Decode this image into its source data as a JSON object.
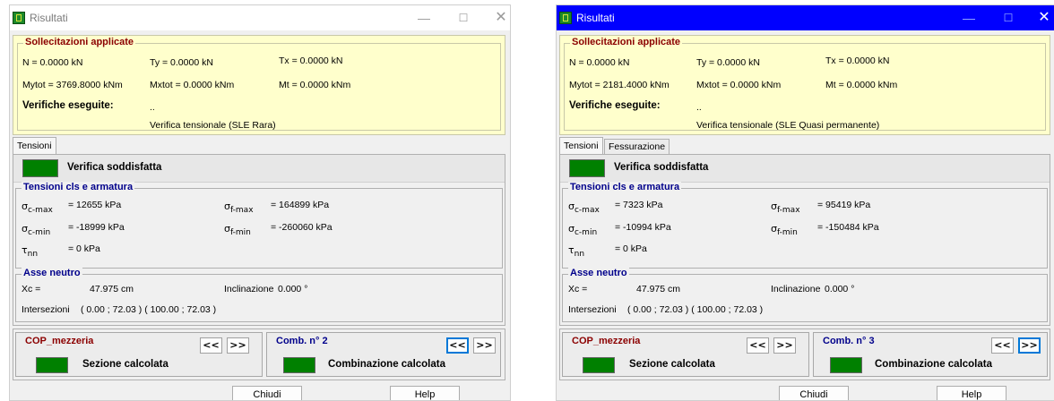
{
  "windows": [
    {
      "title": "Risultati",
      "sollecitazioni": {
        "legend": "Sollecitazioni applicate",
        "N": "N = 0.0000 kN",
        "Ty": "Ty = 0.0000 kN",
        "Tx": "Tx = 0.0000 kN",
        "Mytot": "Mytot = 3769.8000 kNm",
        "Mxtot": "Mxtot = 0.0000 kNm",
        "Mt": "Mt = 0.0000 kNm",
        "verifiche_label": "Verifiche eseguite:",
        "verifiche_value": "..",
        "verifica_tipo": "Verifica tensionale (SLE Rara)"
      },
      "tabs": [
        "Tensioni"
      ],
      "verifica": "Verifica soddisfatta",
      "tensioni": {
        "legend": "Tensioni cls e armatura",
        "sigma": "σ",
        "tau": "τ",
        "sub_cmax": "c-max",
        "sub_cmin": "c-min",
        "sub_fmax": "f-max",
        "sub_fmin": "f-min",
        "sub_nn": "nn",
        "c_max": "= 12655 kPa",
        "c_min": "= -18999 kPa",
        "f_max": "= 164899 kPa",
        "f_min": "= -260060 kPa",
        "nn": "= 0 kPa"
      },
      "asse": {
        "legend": "Asse neutro",
        "xc_label": "Xc =",
        "xc_value": "47.975 cm",
        "incl_label": "Inclinazione",
        "incl_value": "0.000 °",
        "inters_label": "Intersezioni",
        "inters_value": "( 0.00 ; 72.03 ) ( 100.00 ; 72.03 )"
      },
      "sezione": {
        "name": "COP_mezzeria",
        "status": "Sezione calcolata"
      },
      "combinazione": {
        "name": "Comb. n° 2",
        "status": "Combinazione calcolata"
      },
      "nav": {
        "prev": "<<",
        "next": ">>"
      },
      "buttons": {
        "close": "Chiudi",
        "help": "Help"
      }
    },
    {
      "title": "Risultati",
      "sollecitazioni": {
        "legend": "Sollecitazioni applicate",
        "N": "N = 0.0000 kN",
        "Ty": "Ty = 0.0000 kN",
        "Tx": "Tx = 0.0000 kN",
        "Mytot": "Mytot = 2181.4000 kNm",
        "Mxtot": "Mxtot = 0.0000 kNm",
        "Mt": "Mt = 0.0000 kNm",
        "verifiche_label": "Verifiche eseguite:",
        "verifiche_value": "..",
        "verifica_tipo": "Verifica tensionale (SLE Quasi permanente)"
      },
      "tabs": [
        "Tensioni",
        "Fessurazione"
      ],
      "verifica": "Verifica soddisfatta",
      "tensioni": {
        "legend": "Tensioni cls e armatura",
        "sigma": "σ",
        "tau": "τ",
        "sub_cmax": "c-max",
        "sub_cmin": "c-min",
        "sub_fmax": "f-max",
        "sub_fmin": "f-min",
        "sub_nn": "nn",
        "c_max": "= 7323 kPa",
        "c_min": "= -10994 kPa",
        "f_max": "= 95419 kPa",
        "f_min": "= -150484 kPa",
        "nn": "= 0 kPa"
      },
      "asse": {
        "legend": "Asse neutro",
        "xc_label": "Xc =",
        "xc_value": "47.975 cm",
        "incl_label": "Inclinazione",
        "incl_value": "0.000 °",
        "inters_label": "Intersezioni",
        "inters_value": "( 0.00 ; 72.03 ) ( 100.00 ; 72.03 )"
      },
      "sezione": {
        "name": "COP_mezzeria",
        "status": "Sezione calcolata"
      },
      "combinazione": {
        "name": "Comb. n° 3",
        "status": "Combinazione calcolata"
      },
      "nav": {
        "prev": "<<",
        "next": ">>"
      },
      "buttons": {
        "close": "Chiudi",
        "help": "Help"
      }
    }
  ],
  "titlebar_glyphs": {
    "minimize": "—",
    "maximize": "☐",
    "close": "✕"
  },
  "colors": {
    "active_titlebar": "#0000ff",
    "summary_bg": "#ffffcc",
    "ok_green": "#008000",
    "red_label": "#8b0000",
    "blue_label": "#00008b"
  }
}
